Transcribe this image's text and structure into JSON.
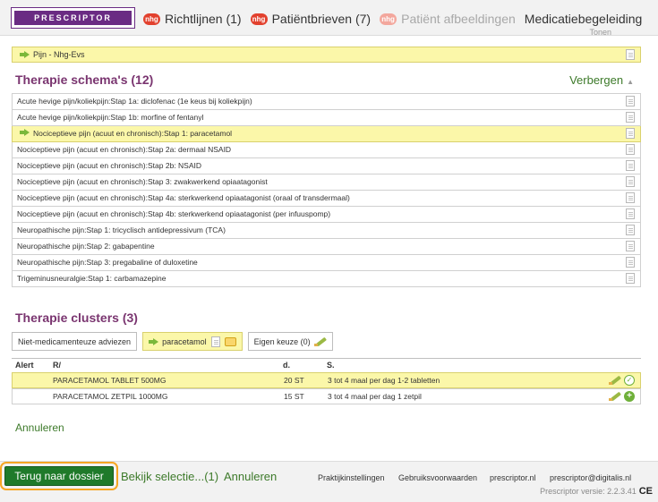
{
  "topnav": {
    "logo": "PRESCRIPTOR",
    "items": [
      {
        "badge": "nhg",
        "label": "Richtlijnen (1)",
        "enabled": true
      },
      {
        "badge": "nhg",
        "label": "Patiëntbrieven (7)",
        "enabled": true
      },
      {
        "badge": "nhg",
        "label": "Patiënt afbeeldingen",
        "enabled": false
      },
      {
        "badge": "",
        "label": "Medicatiebegeleiding",
        "enabled": true
      }
    ],
    "overflow_text": "Tonen"
  },
  "selected_indication": "Pijn - Nhg-Evs",
  "therapie_schemas": {
    "title": "Therapie schema's (12)",
    "toggle_label": "Verbergen",
    "items": [
      {
        "label": "Acute hevige pijn/koliekpijn:Stap 1a: diclofenac (1e keus bij koliekpijn)",
        "selected": false
      },
      {
        "label": "Acute hevige pijn/koliekpijn:Stap 1b: morfine of fentanyl",
        "selected": false
      },
      {
        "label": "Nociceptieve pijn (acuut en chronisch):Stap 1: paracetamol",
        "selected": true
      },
      {
        "label": "Nociceptieve pijn (acuut en chronisch):Stap 2a: dermaal NSAID",
        "selected": false
      },
      {
        "label": "Nociceptieve pijn (acuut en chronisch):Stap 2b: NSAID",
        "selected": false
      },
      {
        "label": "Nociceptieve pijn (acuut en chronisch):Stap 3: zwakwerkend opiaatagonist",
        "selected": false
      },
      {
        "label": "Nociceptieve pijn (acuut en chronisch):Stap 4a: sterkwerkend opiaatagonist (oraal of transdermaal)",
        "selected": false
      },
      {
        "label": "Nociceptieve pijn (acuut en chronisch):Stap 4b: sterkwerkend opiaatagonist (per infuuspomp)",
        "selected": false
      },
      {
        "label": "Neuropathische pijn:Stap 1: tricyclisch antidepressivum (TCA)",
        "selected": false
      },
      {
        "label": "Neuropathische pijn:Stap 2: gabapentine",
        "selected": false
      },
      {
        "label": "Neuropathische pijn:Stap 3: pregabaline of duloxetine",
        "selected": false
      },
      {
        "label": "Trigeminusneuralgie:Stap 1: carbamazepine",
        "selected": false
      }
    ]
  },
  "therapie_clusters": {
    "title": "Therapie clusters (3)",
    "tabs": {
      "niet_medicamenteus": "Niet-medicamenteuze adviezen",
      "paracetamol": "paracetamol",
      "eigen_keuze": "Eigen keuze (0)"
    }
  },
  "medication_table": {
    "headers": {
      "alert": "Alert",
      "r": "R/",
      "d": "d.",
      "s": "S."
    },
    "rows": [
      {
        "name": "PARACETAMOL TABLET 500MG",
        "quantity": "20 ST",
        "dosage": "3 tot 4 maal per dag 1-2 tabletten",
        "selected": true
      },
      {
        "name": "PARACETAMOL ZETPIL 1000MG",
        "quantity": "15 ST",
        "dosage": "3 tot 4 maal per dag 1 zetpil",
        "selected": false
      }
    ]
  },
  "annuleren_label": "Annuleren",
  "footer": {
    "terug_label": "Terug naar dossier",
    "bekijk_label": "Bekijk selectie...(1)",
    "annuleren_label": "Annuleren",
    "praktijk": "Praktijkinstellingen",
    "voorwaarden": "Gebruiksvoorwaarden",
    "site": "prescriptor.nl",
    "email": "prescriptor@digitalis.nl",
    "version": "Prescriptor versie: 2.2.3.41",
    "ce_mark": "CE"
  },
  "colors": {
    "brand": "#6a2b83",
    "accent_green": "#3d7a2a",
    "selected_row": "#fbf7a9",
    "button_green": "#1f7a2a",
    "focus_outline": "#f5a623"
  }
}
